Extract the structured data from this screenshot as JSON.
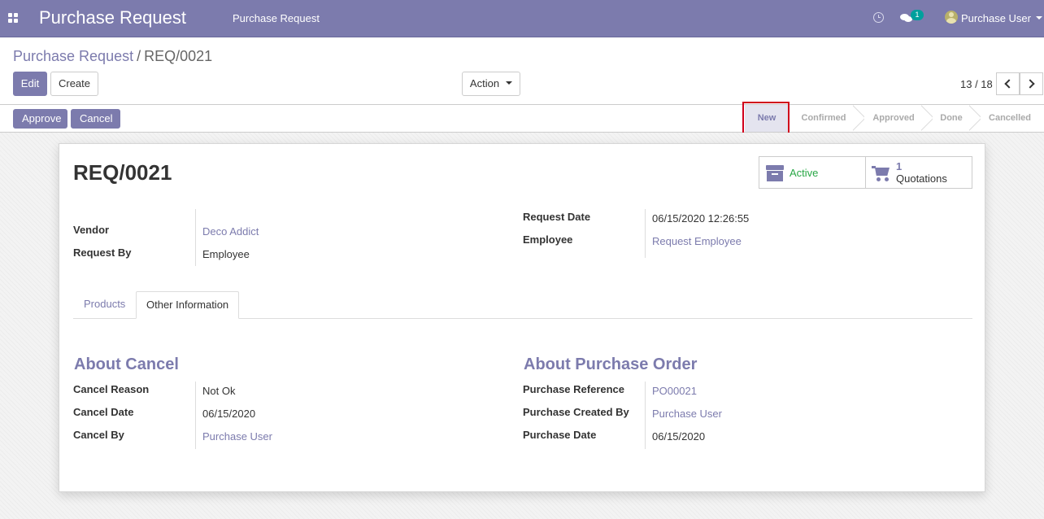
{
  "navbar": {
    "app_title": "Purchase Request",
    "menu_item": "Purchase Request",
    "chat_count": "1",
    "user_name": "Purchase User"
  },
  "breadcrumb": {
    "parent": "Purchase Request",
    "separator": "/",
    "current": "REQ/0021"
  },
  "buttons": {
    "edit": "Edit",
    "create": "Create",
    "action": "Action",
    "approve": "Approve",
    "cancel": "Cancel"
  },
  "pager": {
    "value": "13 / 18"
  },
  "stages": {
    "new": "New",
    "confirmed": "Confirmed",
    "approved": "Approved",
    "done": "Done",
    "cancelled": "Cancelled"
  },
  "record": {
    "title": "REQ/0021",
    "smart_buttons": {
      "active_label": "Active",
      "quotations_count": "1",
      "quotations_label": "Quotations"
    },
    "fields": {
      "vendor_label": "Vendor",
      "vendor_value": "Deco Addict",
      "request_by_label": "Request By",
      "request_by_value": "Employee",
      "request_date_label": "Request Date",
      "request_date_value": "06/15/2020 12:26:55",
      "employee_label": "Employee",
      "employee_value": "Request Employee"
    },
    "tabs": {
      "products": "Products",
      "other_information": "Other Information"
    },
    "about_cancel": {
      "title": "About Cancel",
      "reason_label": "Cancel Reason",
      "reason_value": "Not Ok",
      "date_label": "Cancel Date",
      "date_value": "06/15/2020",
      "by_label": "Cancel By",
      "by_value": "Purchase User"
    },
    "about_purchase_order": {
      "title": "About Purchase Order",
      "reference_label": "Purchase Reference",
      "reference_value": "PO00021",
      "created_by_label": "Purchase Created By",
      "created_by_value": "Purchase User",
      "date_label": "Purchase Date",
      "date_value": "06/15/2020"
    }
  },
  "colors": {
    "brand": "#7c7bad",
    "active_text": "#28a745",
    "highlight_border": "#d0001b"
  },
  "icons": [
    "apps-icon",
    "clock-icon",
    "chat-icon",
    "avatar",
    "chevron-left-icon",
    "chevron-right-icon",
    "archive-icon",
    "cart-icon"
  ]
}
